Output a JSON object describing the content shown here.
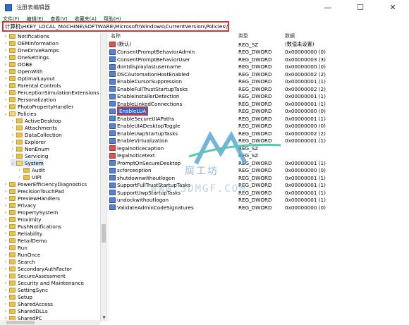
{
  "window": {
    "title": "注册表编辑器",
    "minimize": "—",
    "maximize": "☐",
    "close": "✕"
  },
  "menu": [
    "文件(F)",
    "编辑(E)",
    "查看(V)",
    "收藏夹(A)",
    "帮助(H)"
  ],
  "address": "计算机\\HKEY_LOCAL_MACHINE\\SOFTWARE\\Microsoft\\Windows\\CurrentVersion\\Policies\\System",
  "tree": [
    {
      "label": "Notifications",
      "indent": 0,
      "expanded": false
    },
    {
      "label": "OEMInformation",
      "indent": 0,
      "expanded": false
    },
    {
      "label": "OneDriveRamps",
      "indent": 0,
      "expanded": false
    },
    {
      "label": "OneSettings",
      "indent": 0,
      "expanded": false
    },
    {
      "label": "OOBE",
      "indent": 0,
      "expanded": false
    },
    {
      "label": "OpenWith",
      "indent": 0,
      "expanded": false
    },
    {
      "label": "OptimalLayout",
      "indent": 0,
      "expanded": false
    },
    {
      "label": "Parental Controls",
      "indent": 0,
      "expanded": false
    },
    {
      "label": "PerceptionSimulationExtensions",
      "indent": 0,
      "expanded": false
    },
    {
      "label": "Personalization",
      "indent": 0,
      "expanded": false
    },
    {
      "label": "PhotoPropertyHandler",
      "indent": 0,
      "expanded": false
    },
    {
      "label": "Policies",
      "indent": 0,
      "expanded": true
    },
    {
      "label": "ActiveDesktop",
      "indent": 1,
      "expanded": false
    },
    {
      "label": "Attachments",
      "indent": 1,
      "expanded": false
    },
    {
      "label": "DataCollection",
      "indent": 1,
      "expanded": false
    },
    {
      "label": "Explorer",
      "indent": 1,
      "expanded": false
    },
    {
      "label": "NonEnum",
      "indent": 1,
      "expanded": false
    },
    {
      "label": "Servicing",
      "indent": 1,
      "expanded": false
    },
    {
      "label": "System",
      "indent": 1,
      "expanded": true,
      "selected": true
    },
    {
      "label": "Audit",
      "indent": 2,
      "expanded": false
    },
    {
      "label": "UIPI",
      "indent": 2,
      "expanded": false
    },
    {
      "label": "PowerEfficiencyDiagnostics",
      "indent": 0,
      "expanded": false
    },
    {
      "label": "PrecisionTouchPad",
      "indent": 0,
      "expanded": false
    },
    {
      "label": "PreviewHandlers",
      "indent": 0,
      "expanded": false
    },
    {
      "label": "Privacy",
      "indent": 0,
      "expanded": false
    },
    {
      "label": "PropertySystem",
      "indent": 0,
      "expanded": false
    },
    {
      "label": "Proximity",
      "indent": 0,
      "expanded": false
    },
    {
      "label": "PushNotifications",
      "indent": 0,
      "expanded": false
    },
    {
      "label": "Reliability",
      "indent": 0,
      "expanded": false
    },
    {
      "label": "RetailDemo",
      "indent": 0,
      "expanded": false
    },
    {
      "label": "Run",
      "indent": 0,
      "expanded": false
    },
    {
      "label": "RunOnce",
      "indent": 0,
      "expanded": false
    },
    {
      "label": "Search",
      "indent": 0,
      "expanded": false
    },
    {
      "label": "SecondaryAuthFactor",
      "indent": 0,
      "expanded": false
    },
    {
      "label": "SecureAssessment",
      "indent": 0,
      "expanded": false
    },
    {
      "label": "Security and Maintenance",
      "indent": 0,
      "expanded": false
    },
    {
      "label": "SettingSync",
      "indent": 0,
      "expanded": false
    },
    {
      "label": "Setup",
      "indent": 0,
      "expanded": false
    },
    {
      "label": "SharedAccess",
      "indent": 0,
      "expanded": false
    },
    {
      "label": "SharedDLLs",
      "indent": 0,
      "expanded": false
    },
    {
      "label": "SharedPC",
      "indent": 0,
      "expanded": false
    }
  ],
  "columns": {
    "name": "名称",
    "type": "类型",
    "data": "数据"
  },
  "values": [
    {
      "name": "(默认)",
      "type": "REG_SZ",
      "data": "(数值未设置)",
      "kind": "sz"
    },
    {
      "name": "ConsentPromptBehaviorAdmin",
      "type": "REG_DWORD",
      "data": "0x00000000 (0)",
      "kind": "dword"
    },
    {
      "name": "ConsentPromptBehaviorUser",
      "type": "REG_DWORD",
      "data": "0x00000003 (3)",
      "kind": "dword"
    },
    {
      "name": "dontdisplaylastusername",
      "type": "REG_DWORD",
      "data": "0x00000000 (0)",
      "kind": "dword"
    },
    {
      "name": "DSCAutomationHostEnabled",
      "type": "REG_DWORD",
      "data": "0x00000002 (2)",
      "kind": "dword"
    },
    {
      "name": "EnableCursorSuppression",
      "type": "REG_DWORD",
      "data": "0x00000001 (1)",
      "kind": "dword"
    },
    {
      "name": "EnableFullTrustStartupTasks",
      "type": "REG_DWORD",
      "data": "0x00000002 (2)",
      "kind": "dword"
    },
    {
      "name": "EnableInstallerDetection",
      "type": "REG_DWORD",
      "data": "0x00000001 (1)",
      "kind": "dword"
    },
    {
      "name": "EnableLinkedConnections",
      "type": "REG_DWORD",
      "data": "0x00000001 (1)",
      "kind": "dword"
    },
    {
      "name": "EnableLUA",
      "type": "REG_DWORD",
      "data": "0x00000000 (0)",
      "kind": "dword",
      "highlight": true
    },
    {
      "name": "EnableSecureUIAPaths",
      "type": "REG_DWORD",
      "data": "0x00000001 (1)",
      "kind": "dword"
    },
    {
      "name": "EnableUIADesktopToggle",
      "type": "REG_DWORD",
      "data": "0x00000000 (0)",
      "kind": "dword"
    },
    {
      "name": "EnableUwpStartupTasks",
      "type": "REG_DWORD",
      "data": "0x00000002 (2)",
      "kind": "dword"
    },
    {
      "name": "EnableVirtualization",
      "type": "REG_DWORD",
      "data": "0x00000001 (1)",
      "kind": "dword"
    },
    {
      "name": "legalnoticecaption",
      "type": "REG_SZ",
      "data": "",
      "kind": "sz"
    },
    {
      "name": "legalnoticetext",
      "type": "REG_SZ",
      "data": "",
      "kind": "sz"
    },
    {
      "name": "PromptOnSecureDesktop",
      "type": "REG_DWORD",
      "data": "0x00000001 (1)",
      "kind": "dword"
    },
    {
      "name": "scforceoption",
      "type": "REG_DWORD",
      "data": "0x00000000 (0)",
      "kind": "dword"
    },
    {
      "name": "shutdownwithoutlogon",
      "type": "REG_DWORD",
      "data": "0x00000001 (1)",
      "kind": "dword"
    },
    {
      "name": "SupportFullTrustStartupTasks",
      "type": "REG_DWORD",
      "data": "0x00000001 (1)",
      "kind": "dword"
    },
    {
      "name": "SupportUwpStartupTasks",
      "type": "REG_DWORD",
      "data": "0x00000001 (1)",
      "kind": "dword"
    },
    {
      "name": "undockwithoutlogon",
      "type": "REG_DWORD",
      "data": "0x00000001 (1)",
      "kind": "dword"
    },
    {
      "name": "ValidateAdminCodeSignatures",
      "type": "REG_DWORD",
      "data": "0x00000000 (0)",
      "kind": "dword"
    }
  ],
  "watermark": {
    "line1": "腐工坊",
    "line2": "WWW.3DMGF.COM"
  }
}
